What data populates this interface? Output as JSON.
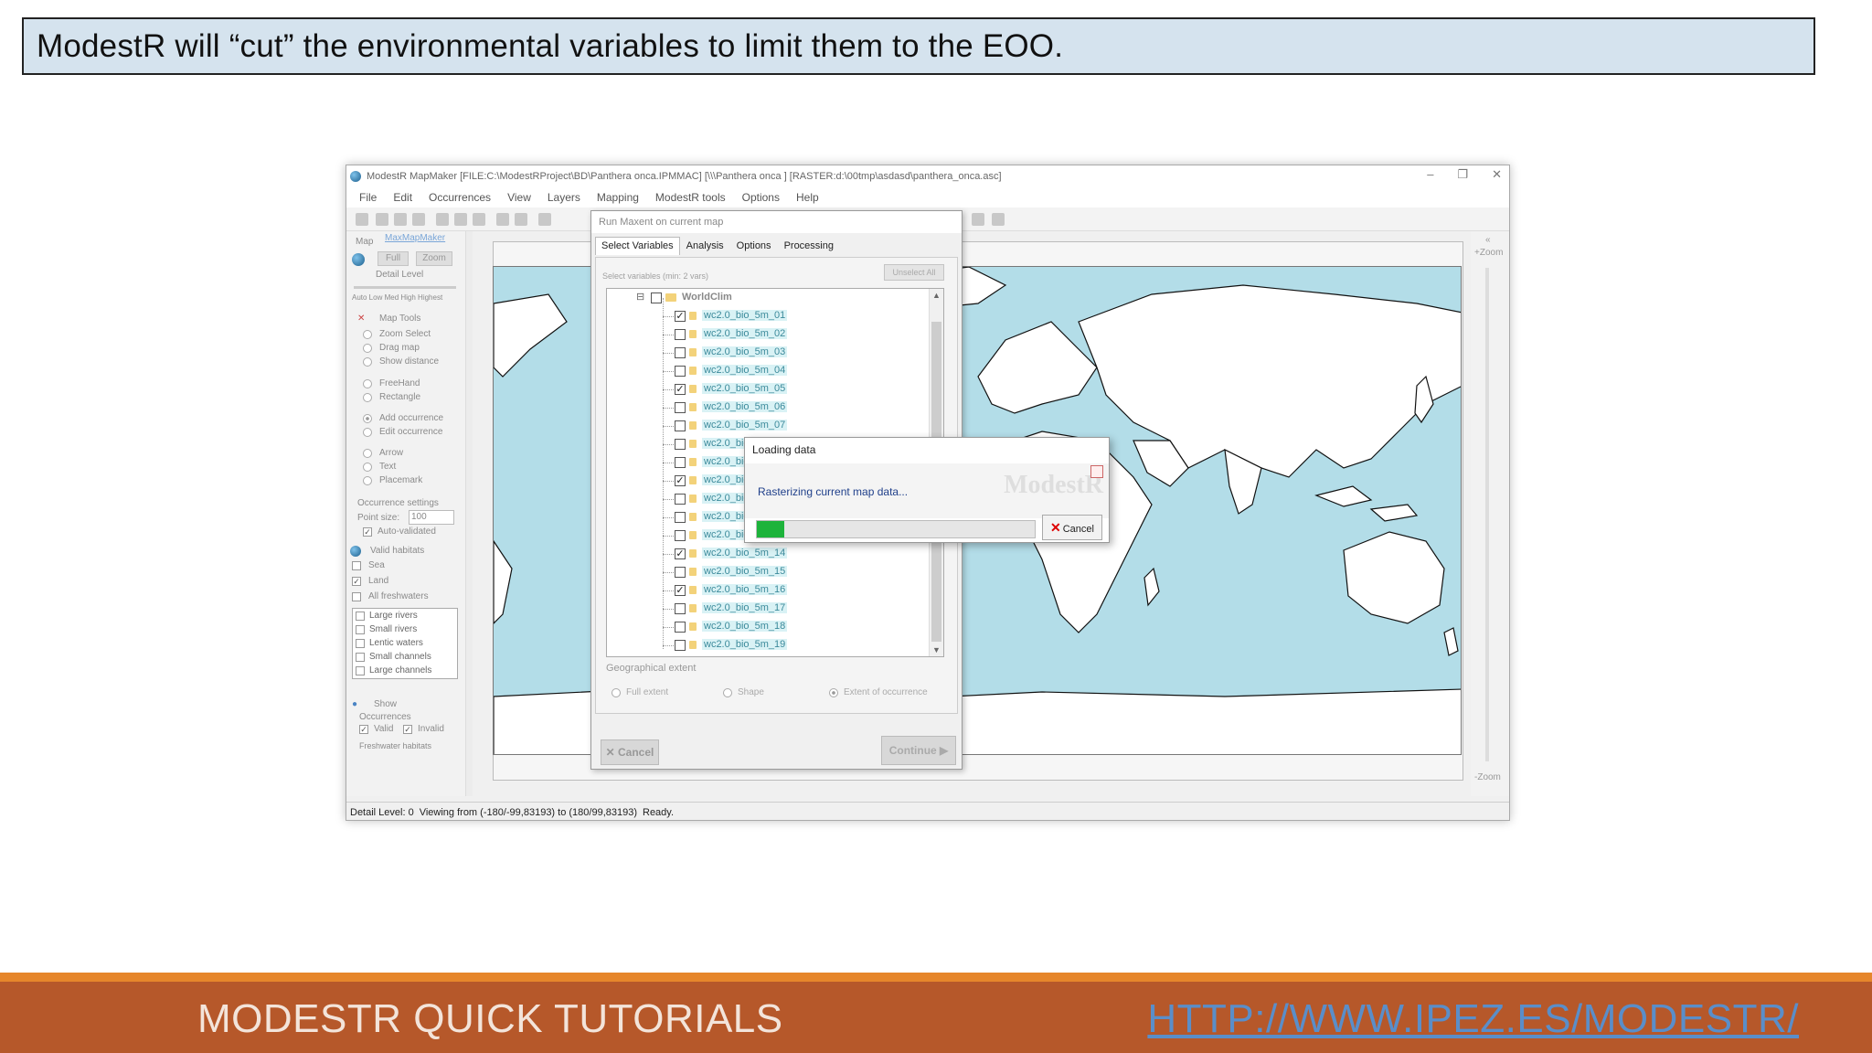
{
  "caption": "ModestR will “cut” the environmental variables to limit them to the EOO.",
  "window": {
    "title": "ModestR MapMaker [FILE:C:\\ModestRProject\\BD\\Panthera onca.IPMMAC] [\\\\\\Panthera onca ] [RASTER:d:\\00tmp\\asdasd\\panthera_onca.asc]",
    "controls": [
      "–",
      "❐",
      "✕"
    ],
    "menu": [
      "File",
      "Edit",
      "Occurrences",
      "View",
      "Layers",
      "Mapping",
      "ModestR tools",
      "Options",
      "Help"
    ]
  },
  "leftpanel": {
    "map_label": "Map",
    "map_source": "MaxMapMaker",
    "full_btn": "Full",
    "zoom_btn": "Zoom",
    "detail_label": "Detail Level",
    "detail_levels": "Auto Low  Med  High  Highest",
    "map_tools": "Map Tools",
    "tools": [
      "Zoom Select",
      "Drag map",
      "Show distance",
      "FreeHand",
      "Rectangle",
      "Add occurrence",
      "Edit occurrence",
      "Arrow",
      "Text",
      "Placemark"
    ],
    "occ_settings": "Occurrence settings",
    "point_size_label": "Point size:",
    "point_size_value": "100",
    "auto_validated": "Auto-validated",
    "valid_habitats": "Valid habitats",
    "habitats": [
      "Sea",
      "Land",
      "All freshwaters"
    ],
    "freshwater_list": [
      "Large rivers",
      "Small rivers",
      "Lentic waters",
      "Small channels",
      "Large channels"
    ],
    "show": "Show",
    "occurrences": "Occurrences",
    "valid": "Valid",
    "invalid": "Invalid",
    "freshwater_habitats": "Freshwater habitats"
  },
  "rightpanel": {
    "top": "+Zoom",
    "bottom": "-Zoom",
    "collapse": "«"
  },
  "statusbar": {
    "detail": "Detail Level: 0",
    "viewing": "Viewing from (-180/-99,83193) to (180/99,83193)",
    "state": "Ready."
  },
  "maxent_dialog": {
    "title": "Run Maxent on current map",
    "tabs": [
      "Select Variables",
      "Analysis",
      "Options",
      "Processing"
    ],
    "select_hint": "Select variables (min: 2 vars)",
    "unselect_btn": "Unselect All",
    "root": "WorldClim",
    "variables": [
      {
        "name": "wc2.0_bio_5m_01",
        "checked": true
      },
      {
        "name": "wc2.0_bio_5m_02",
        "checked": false
      },
      {
        "name": "wc2.0_bio_5m_03",
        "checked": false
      },
      {
        "name": "wc2.0_bio_5m_04",
        "checked": false
      },
      {
        "name": "wc2.0_bio_5m_05",
        "checked": true
      },
      {
        "name": "wc2.0_bio_5m_06",
        "checked": false
      },
      {
        "name": "wc2.0_bio_5m_07",
        "checked": false
      },
      {
        "name": "wc2.0_bio_5m_08",
        "checked": false
      },
      {
        "name": "wc2.0_bio_5m_09",
        "checked": false
      },
      {
        "name": "wc2.0_bio_5m_10",
        "checked": true
      },
      {
        "name": "wc2.0_bio_5m_11",
        "checked": false
      },
      {
        "name": "wc2.0_bio_5m_12",
        "checked": false
      },
      {
        "name": "wc2.0_bio_5m_13",
        "checked": false
      },
      {
        "name": "wc2.0_bio_5m_14",
        "checked": true
      },
      {
        "name": "wc2.0_bio_5m_15",
        "checked": false
      },
      {
        "name": "wc2.0_bio_5m_16",
        "checked": true
      },
      {
        "name": "wc2.0_bio_5m_17",
        "checked": false
      },
      {
        "name": "wc2.0_bio_5m_18",
        "checked": false
      },
      {
        "name": "wc2.0_bio_5m_19",
        "checked": false
      }
    ],
    "geo_label": "Geographical extent",
    "geo_options": [
      "Full extent",
      "Shape",
      "Extent of occurrence"
    ],
    "geo_selected": "Extent of occurrence",
    "cancel": "Cancel",
    "continue": "Continue"
  },
  "loading_dialog": {
    "title": "Loading data",
    "message": "Rasterizing current map data...",
    "watermark": "ModestR",
    "progress": 0.1,
    "cancel": "Cancel"
  },
  "colors": {
    "progress": "#1db33b",
    "footer": "#b6582a",
    "footer_line": "#e6862b",
    "ocean": "#b3dde8"
  },
  "footer": {
    "left": "MODESTR QUICK TUTORIALS",
    "right": "HTTP://WWW.IPEZ.ES/MODESTR/"
  }
}
